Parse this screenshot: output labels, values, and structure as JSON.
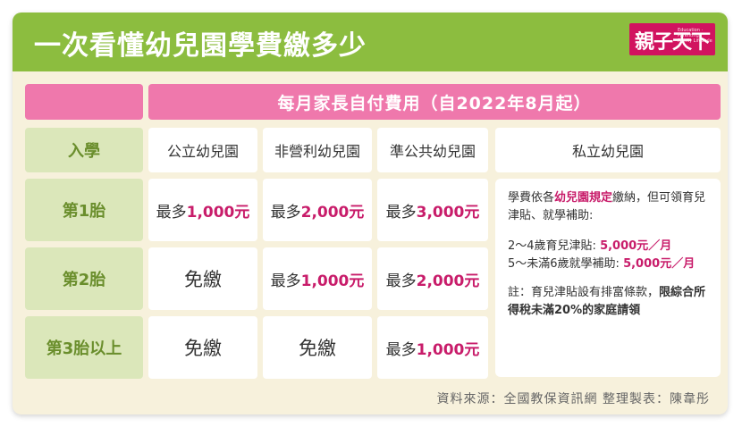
{
  "title": "一次看懂幼兒園學費繳多少",
  "logo": {
    "main": "親子天下",
    "sub": "Education · Parenting Family Lifestyle"
  },
  "band": "每月家長自付費用（自2022年8月起）",
  "col_headers": [
    "入學",
    "公立幼兒園",
    "非營利幼兒園",
    "準公共幼兒園",
    "私立幼兒園"
  ],
  "rows": [
    {
      "label": "第1胎",
      "public": {
        "pre": "最多",
        "amt": "1,000元"
      },
      "nonprofit": {
        "pre": "最多",
        "amt": "2,000元"
      },
      "quasi": {
        "pre": "最多",
        "amt": "3,000元"
      }
    },
    {
      "label": "第2胎",
      "public": {
        "text": "免繳"
      },
      "nonprofit": {
        "pre": "最多",
        "amt": "1,000元"
      },
      "quasi": {
        "pre": "最多",
        "amt": "2,000元"
      }
    },
    {
      "label": "第3胎以上",
      "public": {
        "text": "免繳"
      },
      "nonprofit": {
        "text": "免繳"
      },
      "quasi": {
        "pre": "最多",
        "amt": "1,000元"
      }
    }
  ],
  "private": {
    "p1_a": "學費依各",
    "p1_b": "幼兒園規定",
    "p1_c": "繳納，但可領育兒津貼、就學補助:",
    "l1_a": "2～4歲育兒津貼:",
    "l1_b": "5,000元／月",
    "l2_a": "5～未滿6歲就學補助:",
    "l2_b": "5,000元／月",
    "note_a": "註：育兒津貼設有排富條款，",
    "note_b": "限綜合所得稅未滿20%的家庭請領"
  },
  "source": "資料來源：全國教保資訊網 整理製表：陳韋彤"
}
